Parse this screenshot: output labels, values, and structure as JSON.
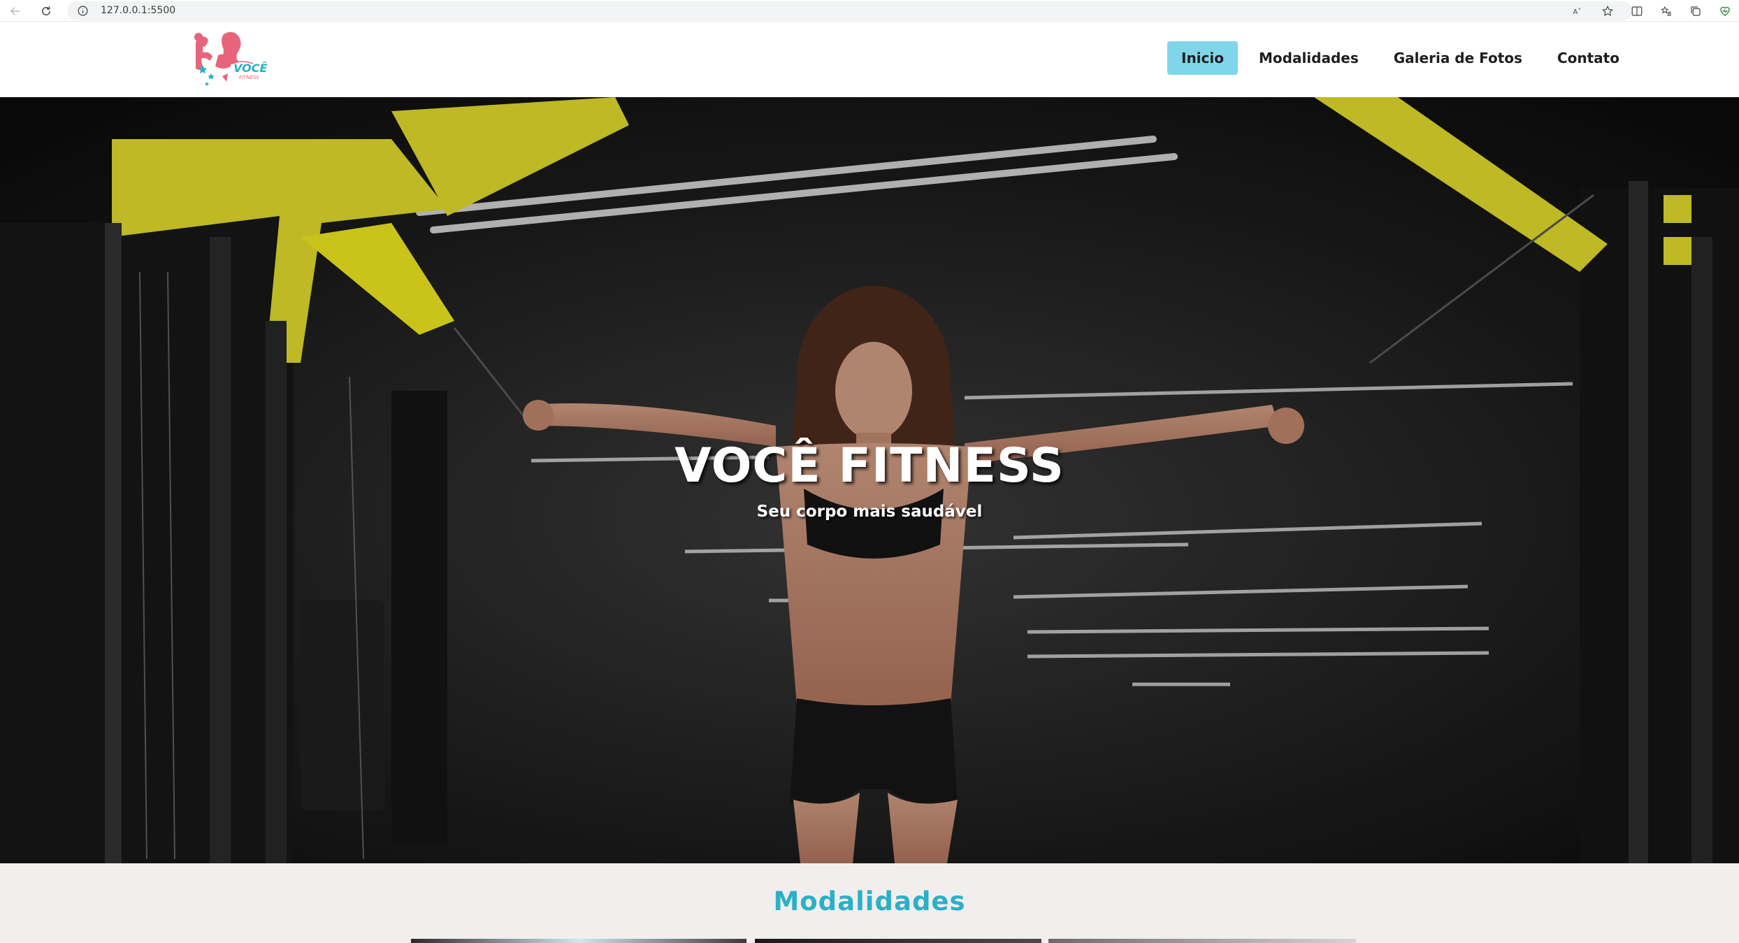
{
  "browser": {
    "url": "127.0.0.1:5500"
  },
  "site": {
    "logo_text": "VOCÊ",
    "logo_subtext": "FITNESS",
    "nav": [
      {
        "label": "Inicio",
        "active": true
      },
      {
        "label": "Modalidades",
        "active": false
      },
      {
        "label": "Galeria de Fotos",
        "active": false
      },
      {
        "label": "Contato",
        "active": false
      }
    ]
  },
  "hero": {
    "title": "VOCÊ FITNESS",
    "subtitle": "Seu corpo mais saudável"
  },
  "sections": {
    "modalidades_title": "Modalidades"
  },
  "colors": {
    "accent": "#2bb0c8",
    "nav_active_bg": "#7fd6ea",
    "logo_pink": "#e8647a",
    "machine_yellow": "#e6e01e",
    "section_bg": "#f3eeee"
  }
}
